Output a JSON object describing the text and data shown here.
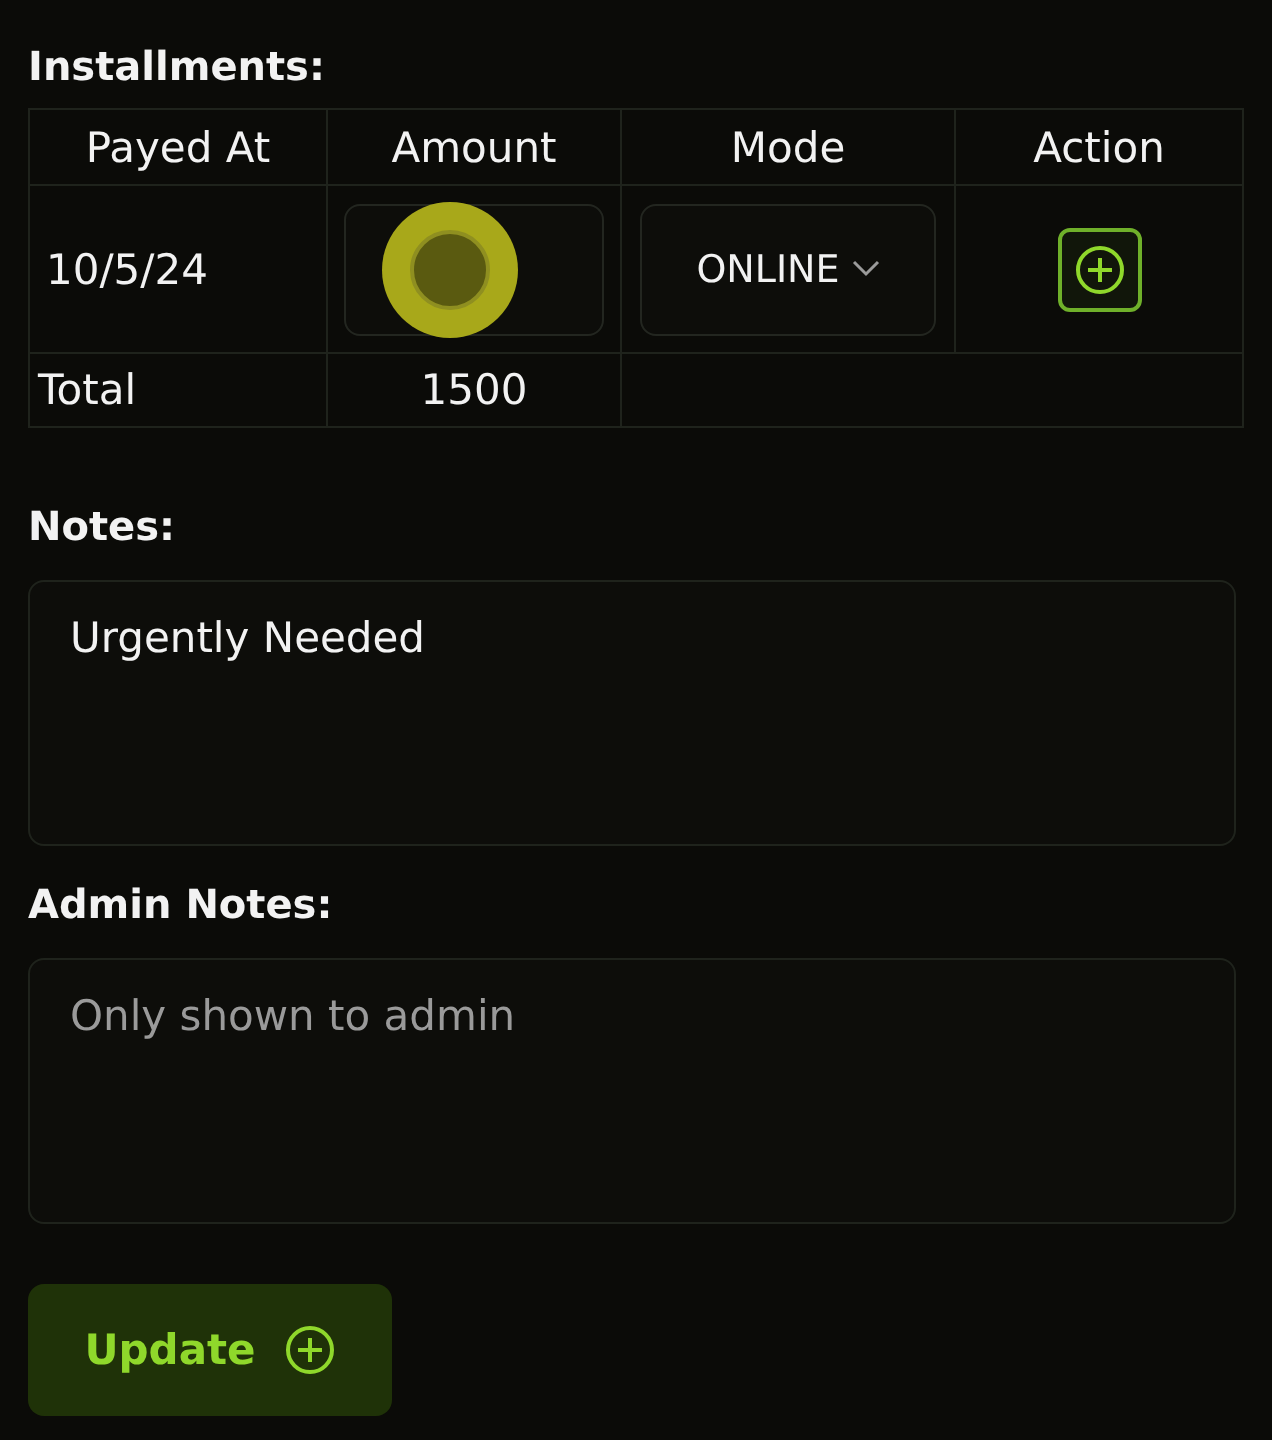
{
  "installments": {
    "label": "Installments:",
    "columns": [
      "Payed At",
      "Amount",
      "Mode",
      "Action"
    ],
    "rows": [
      {
        "payed_at": "10/5/24",
        "mode": "ONLINE"
      }
    ],
    "total": {
      "label": "Total",
      "amount": "1500"
    }
  },
  "notes": {
    "label": "Notes:",
    "value": "Urgently Needed"
  },
  "admin_notes": {
    "label": "Admin Notes:",
    "placeholder": "Only shown to admin"
  },
  "button": {
    "label": "Update"
  }
}
